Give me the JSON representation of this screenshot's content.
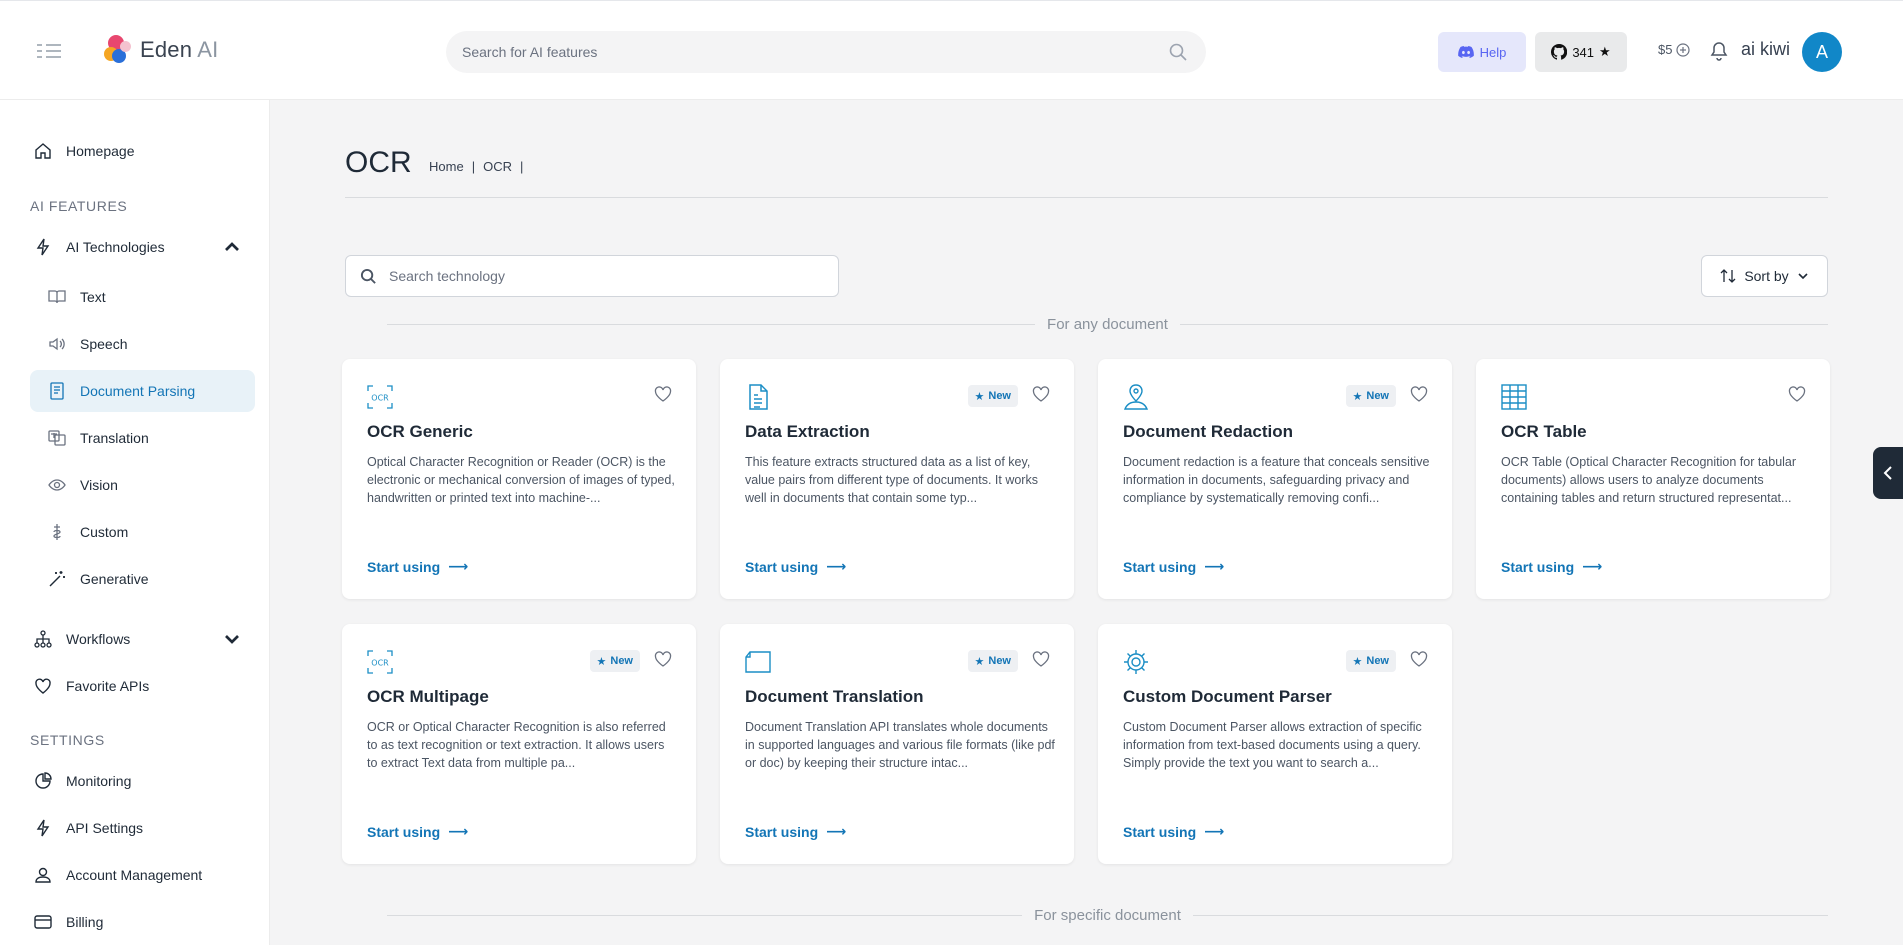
{
  "header": {
    "logo_text": "Eden",
    "logo_ai": "AI",
    "search_placeholder": "Search for AI features",
    "help_label": "Help",
    "github_stars": "341",
    "credit": "$5",
    "username": "ai kiwi",
    "avatar_initial": "A"
  },
  "sidebar": {
    "homepage": "Homepage",
    "ai_features_label": "AI FEATURES",
    "ai_technologies": "AI Technologies",
    "sub_items": [
      "Text",
      "Speech",
      "Document Parsing",
      "Translation",
      "Vision",
      "Custom",
      "Generative"
    ],
    "active_item": "Document Parsing",
    "workflows": "Workflows",
    "favorite_apis": "Favorite APIs",
    "settings_label": "SETTINGS",
    "monitoring": "Monitoring",
    "api_settings": "API Settings",
    "account_management": "Account Management",
    "billing": "Billing"
  },
  "main": {
    "title": "OCR",
    "breadcrumb": [
      "Home",
      "|",
      "OCR",
      "|"
    ],
    "tech_search_placeholder": "Search technology",
    "sort_label": "Sort by",
    "group_any": "For any document",
    "group_specific": "For specific document",
    "cta_label": "Start using",
    "new_label": "New",
    "cards": [
      {
        "title": "OCR Generic",
        "icon": "ocr-icon",
        "new": false,
        "desc": "Optical Character Recognition or Reader (OCR) is the electronic or mechanical conversion of images of typed, handwritten or printed text into machine-..."
      },
      {
        "title": "Data Extraction",
        "icon": "document-data-icon",
        "new": true,
        "desc": "This feature extracts structured data as a list of key, value pairs from different type of documents. It works well in documents that contain some typ..."
      },
      {
        "title": "Document Redaction",
        "icon": "user-shield-icon",
        "new": true,
        "desc": "Document redaction is a feature that conceals sensitive information in documents, safeguarding privacy and compliance by systematically removing confi..."
      },
      {
        "title": "OCR Table",
        "icon": "table-icon",
        "new": false,
        "desc": "OCR Table (Optical Character Recognition for tabular documents) allows users to analyze documents containing tables and return structured representat..."
      },
      {
        "title": "OCR Multipage",
        "icon": "ocr-icon",
        "new": true,
        "desc": "OCR or Optical Character Recognition is also referred to as text recognition or text extraction. It allows users to extract Text data from multiple pa..."
      },
      {
        "title": "Document Translation",
        "icon": "folder-icon",
        "new": true,
        "desc": "Document Translation API translates whole documents in supported languages and various file formats (like pdf or doc) by keeping their structure intac..."
      },
      {
        "title": "Custom Document Parser",
        "icon": "gear-icon",
        "new": true,
        "desc": "Custom Document Parser allows extraction of specific information from text-based documents using a query. Simply provide the text you want to search a..."
      }
    ]
  }
}
